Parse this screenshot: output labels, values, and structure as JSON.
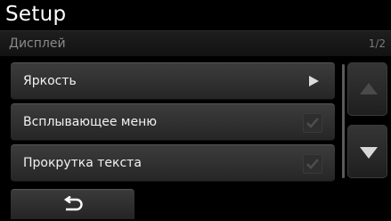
{
  "header": {
    "title": "Setup"
  },
  "subheader": {
    "title": "Дисплей",
    "page_indicator": "1/2"
  },
  "menu": {
    "items": [
      {
        "label": "Яркость",
        "control": "arrow-right-icon"
      },
      {
        "label": "Всплывающее меню",
        "control": "checkbox",
        "checked": true
      },
      {
        "label": "Прокрутка текста",
        "control": "checkbox",
        "checked": true
      }
    ]
  },
  "scroll": {
    "up_icon": "triangle-up-icon",
    "down_icon": "triangle-down-icon",
    "up_enabled": false,
    "down_enabled": true
  },
  "footer": {
    "back_icon": "back-arrow-icon"
  },
  "colors": {
    "background": "#000000",
    "button": "#2e2e2e",
    "text": "#ffffff",
    "muted_text": "#8a8a8a"
  }
}
